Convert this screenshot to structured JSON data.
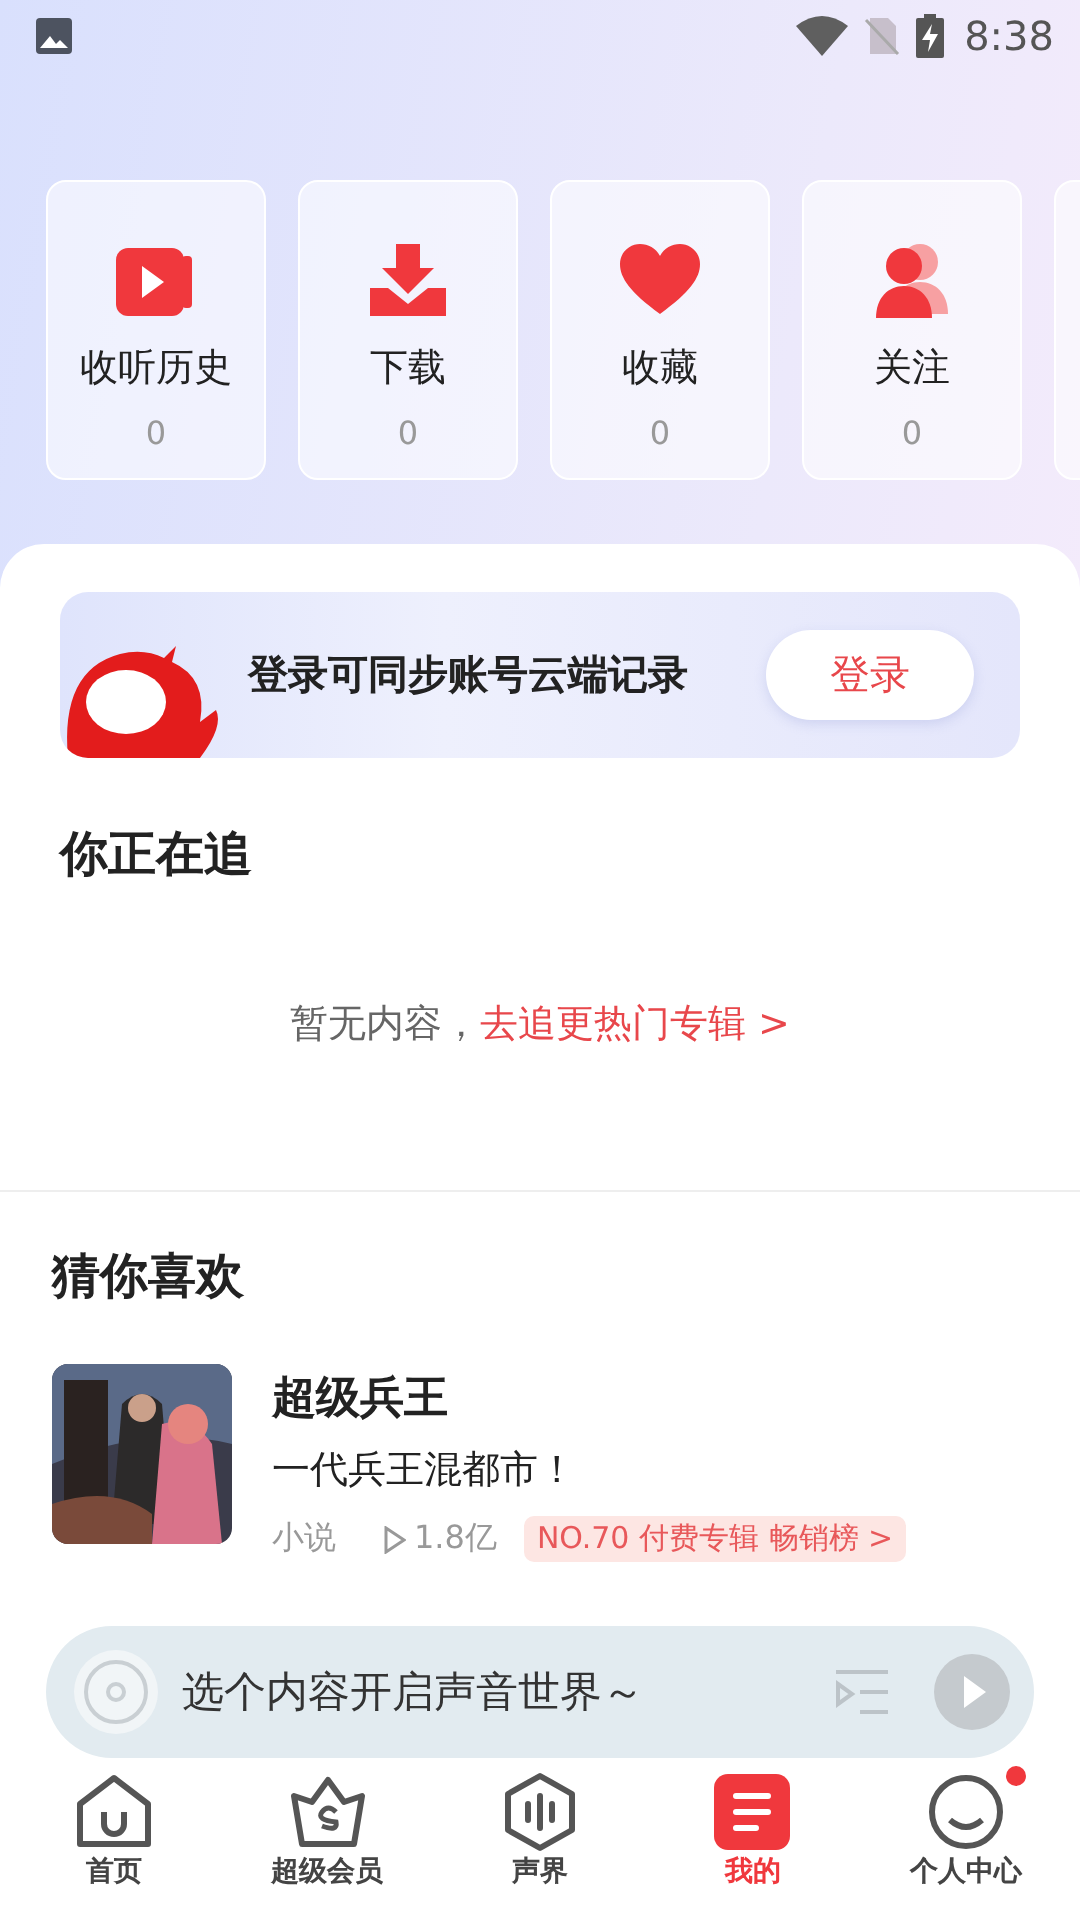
{
  "status_bar": {
    "time": "8:38"
  },
  "stats": [
    {
      "kind": "history",
      "label": "收听历史",
      "count": "0"
    },
    {
      "kind": "download",
      "label": "下载",
      "count": "0"
    },
    {
      "kind": "favorite",
      "label": "收藏",
      "count": "0"
    },
    {
      "kind": "follow",
      "label": "关注",
      "count": "0"
    }
  ],
  "login_banner": {
    "text": "登录可同步账号云端记录",
    "button": "登录"
  },
  "following": {
    "title": "你正在追",
    "empty_text": "暂无内容，",
    "link": "去追更热门专辑 >"
  },
  "recommend": {
    "title": "猜你喜欢",
    "items": [
      {
        "title": "超级兵王",
        "subtitle": "一代兵王混都市！",
        "category": "小说",
        "plays": "1.8亿",
        "rank_tag": "NO.70 付费专辑 畅销榜 >"
      }
    ]
  },
  "player": {
    "prompt": "选个内容开启声音世界～"
  },
  "nav": [
    {
      "kind": "home",
      "label": "首页",
      "selected": false,
      "badge": false
    },
    {
      "kind": "vip",
      "label": "超级会员",
      "selected": false,
      "badge": false
    },
    {
      "kind": "voice",
      "label": "声界",
      "selected": false,
      "badge": false
    },
    {
      "kind": "mine",
      "label": "我的",
      "selected": true,
      "badge": false
    },
    {
      "kind": "person",
      "label": "个人中心",
      "selected": false,
      "badge": true
    }
  ]
}
